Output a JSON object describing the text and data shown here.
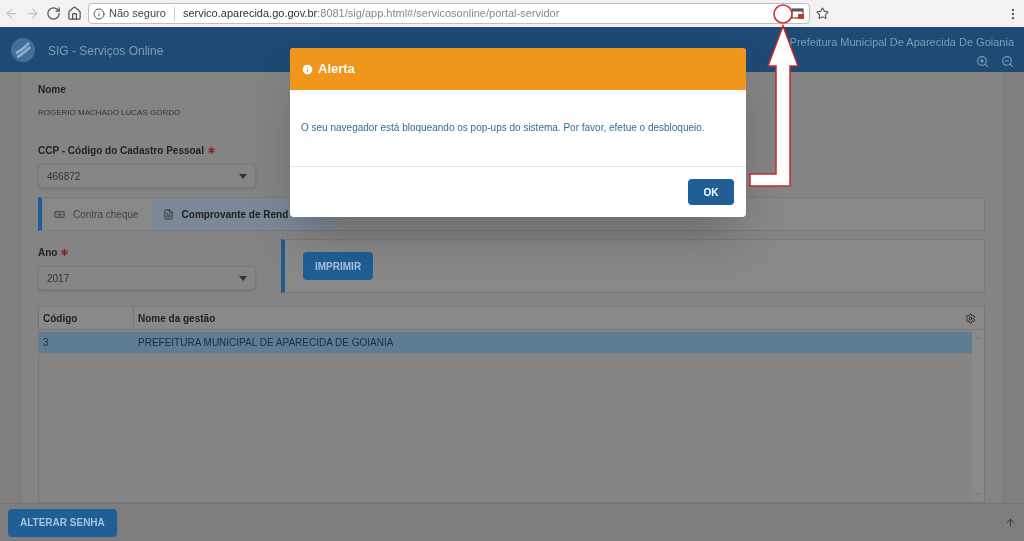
{
  "browser": {
    "nav": [
      {
        "kind": "back",
        "disabled": true
      },
      {
        "kind": "forward",
        "disabled": true
      },
      {
        "kind": "reload",
        "disabled": false
      },
      {
        "kind": "home",
        "disabled": false
      }
    ],
    "security": "Não seguro",
    "url_host": "servico.aparecida.go.gov.br",
    "url_path": ":8081/sig/app.html#/servicosonline/portal-servidor",
    "popup_blocked": true
  },
  "header": {
    "title": "SIG - Serviços Online",
    "organization": "Prefeitura Municipal De Aparecida De Goiania"
  },
  "form": {
    "name_label": "Nome",
    "name_value": "ROGERIO MACHADO LUCAS GORDO",
    "ccp": {
      "label": "CCP - Código do Cadastro Pessoal",
      "required": true,
      "value": "466872"
    },
    "tabs": [
      {
        "kind": "money",
        "label": "Contra cheque",
        "selected": false
      },
      {
        "kind": "document",
        "label": "Comprovante de Rend",
        "selected": true
      }
    ],
    "year": {
      "label": "Ano",
      "required": true,
      "value": "2017"
    },
    "print_button": "IMPRIMIR"
  },
  "table": {
    "columns": [
      "Código",
      "Nome da gestão"
    ],
    "rows": [
      {
        "cells": [
          "3",
          "PREFEITURA MUNICIPAL DE APARECIDA DE GOIANIA"
        ],
        "selected": true
      }
    ]
  },
  "footer": {
    "button": "ALTERAR SENHA"
  },
  "dialog": {
    "title": "Alerta",
    "message": "O seu navegador está bloqueando os pop-ups do sistema. Por favor, efetue o desbloqueio.",
    "button": "OK"
  }
}
